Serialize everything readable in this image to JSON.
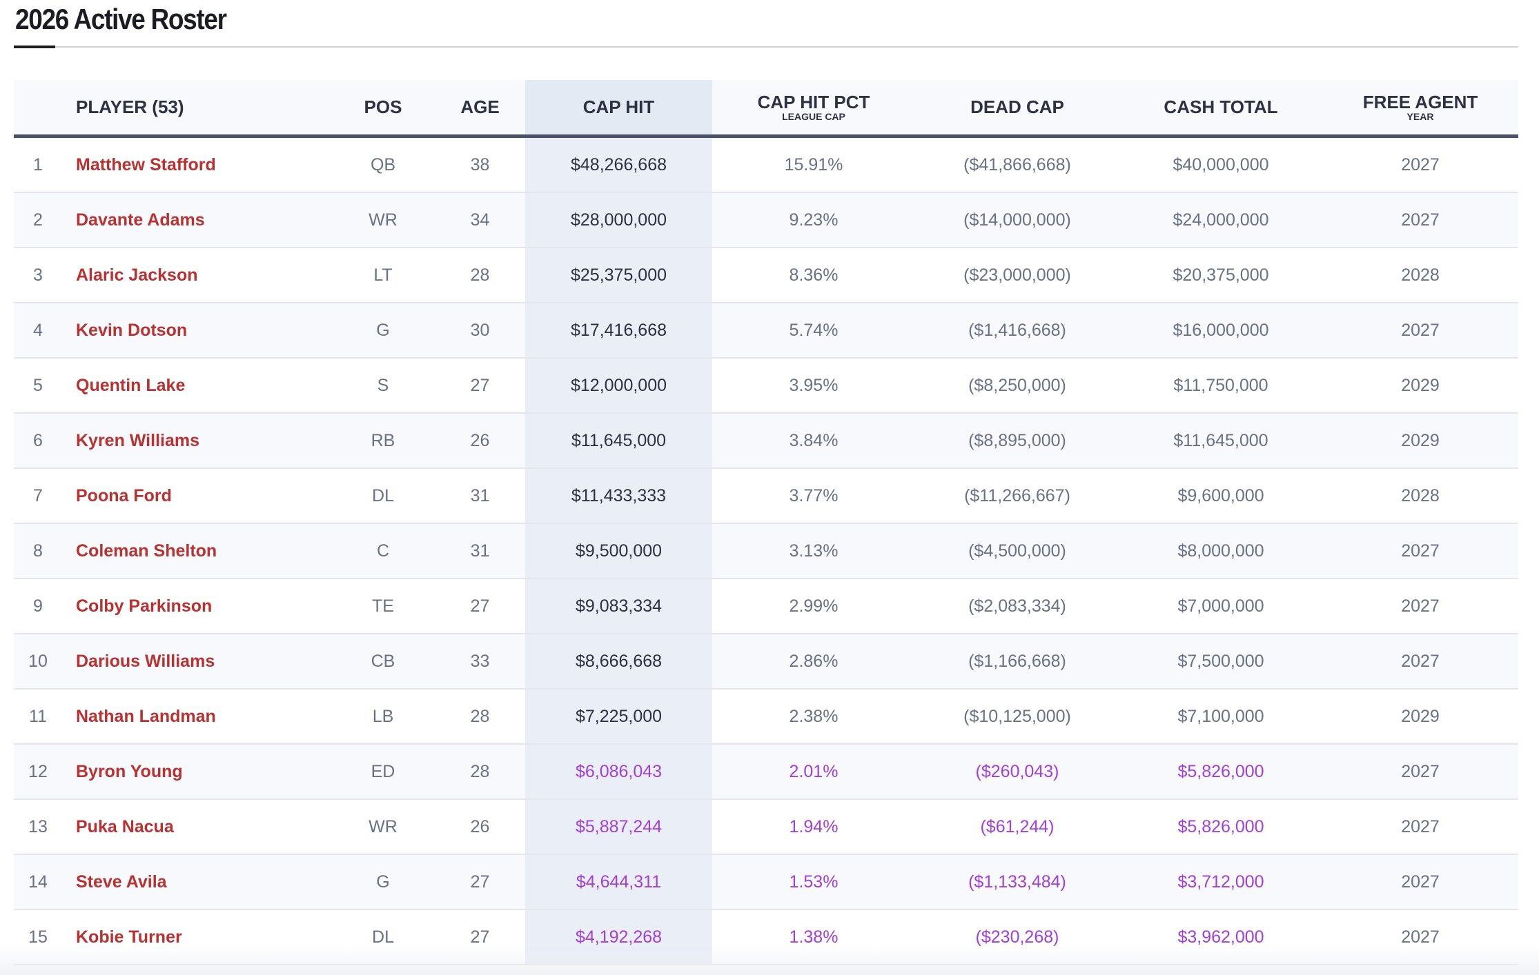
{
  "title": "2026 Active Roster",
  "columns": {
    "player": "PLAYER (53)",
    "pos": "POS",
    "age": "AGE",
    "cap_hit": "CAP HIT",
    "cap_pct": "CAP HIT PCT",
    "cap_pct_sub": "LEAGUE CAP",
    "dead_cap": "DEAD CAP",
    "cash_total": "CASH TOTAL",
    "fa": "FREE AGENT",
    "fa_sub": "YEAR"
  },
  "colors": {
    "player_link": "#b83232",
    "highlight": "#a23fd9",
    "cap_col_bg": "#e9eef7"
  },
  "rows": [
    {
      "n": "1",
      "name": "Matthew Stafford",
      "pos": "QB",
      "age": "38",
      "cap": "$48,266,668",
      "pct": "15.91%",
      "dead": "($41,866,668)",
      "cash": "$40,000,000",
      "fa": "2027",
      "hl": false
    },
    {
      "n": "2",
      "name": "Davante Adams",
      "pos": "WR",
      "age": "34",
      "cap": "$28,000,000",
      "pct": "9.23%",
      "dead": "($14,000,000)",
      "cash": "$24,000,000",
      "fa": "2027",
      "hl": false
    },
    {
      "n": "3",
      "name": "Alaric Jackson",
      "pos": "LT",
      "age": "28",
      "cap": "$25,375,000",
      "pct": "8.36%",
      "dead": "($23,000,000)",
      "cash": "$20,375,000",
      "fa": "2028",
      "hl": false
    },
    {
      "n": "4",
      "name": "Kevin Dotson",
      "pos": "G",
      "age": "30",
      "cap": "$17,416,668",
      "pct": "5.74%",
      "dead": "($1,416,668)",
      "cash": "$16,000,000",
      "fa": "2027",
      "hl": false
    },
    {
      "n": "5",
      "name": "Quentin Lake",
      "pos": "S",
      "age": "27",
      "cap": "$12,000,000",
      "pct": "3.95%",
      "dead": "($8,250,000)",
      "cash": "$11,750,000",
      "fa": "2029",
      "hl": false
    },
    {
      "n": "6",
      "name": "Kyren Williams",
      "pos": "RB",
      "age": "26",
      "cap": "$11,645,000",
      "pct": "3.84%",
      "dead": "($8,895,000)",
      "cash": "$11,645,000",
      "fa": "2029",
      "hl": false
    },
    {
      "n": "7",
      "name": "Poona Ford",
      "pos": "DL",
      "age": "31",
      "cap": "$11,433,333",
      "pct": "3.77%",
      "dead": "($11,266,667)",
      "cash": "$9,600,000",
      "fa": "2028",
      "hl": false
    },
    {
      "n": "8",
      "name": "Coleman Shelton",
      "pos": "C",
      "age": "31",
      "cap": "$9,500,000",
      "pct": "3.13%",
      "dead": "($4,500,000)",
      "cash": "$8,000,000",
      "fa": "2027",
      "hl": false
    },
    {
      "n": "9",
      "name": "Colby Parkinson",
      "pos": "TE",
      "age": "27",
      "cap": "$9,083,334",
      "pct": "2.99%",
      "dead": "($2,083,334)",
      "cash": "$7,000,000",
      "fa": "2027",
      "hl": false
    },
    {
      "n": "10",
      "name": "Darious Williams",
      "pos": "CB",
      "age": "33",
      "cap": "$8,666,668",
      "pct": "2.86%",
      "dead": "($1,166,668)",
      "cash": "$7,500,000",
      "fa": "2027",
      "hl": false
    },
    {
      "n": "11",
      "name": "Nathan Landman",
      "pos": "LB",
      "age": "28",
      "cap": "$7,225,000",
      "pct": "2.38%",
      "dead": "($10,125,000)",
      "cash": "$7,100,000",
      "fa": "2029",
      "hl": false
    },
    {
      "n": "12",
      "name": "Byron Young",
      "pos": "ED",
      "age": "28",
      "cap": "$6,086,043",
      "pct": "2.01%",
      "dead": "($260,043)",
      "cash": "$5,826,000",
      "fa": "2027",
      "hl": true
    },
    {
      "n": "13",
      "name": "Puka Nacua",
      "pos": "WR",
      "age": "26",
      "cap": "$5,887,244",
      "pct": "1.94%",
      "dead": "($61,244)",
      "cash": "$5,826,000",
      "fa": "2027",
      "hl": true
    },
    {
      "n": "14",
      "name": "Steve Avila",
      "pos": "G",
      "age": "27",
      "cap": "$4,644,311",
      "pct": "1.53%",
      "dead": "($1,133,484)",
      "cash": "$3,712,000",
      "fa": "2027",
      "hl": true
    },
    {
      "n": "15",
      "name": "Kobie Turner",
      "pos": "DL",
      "age": "27",
      "cap": "$4,192,268",
      "pct": "1.38%",
      "dead": "($230,268)",
      "cash": "$3,962,000",
      "fa": "2027",
      "hl": true
    }
  ]
}
